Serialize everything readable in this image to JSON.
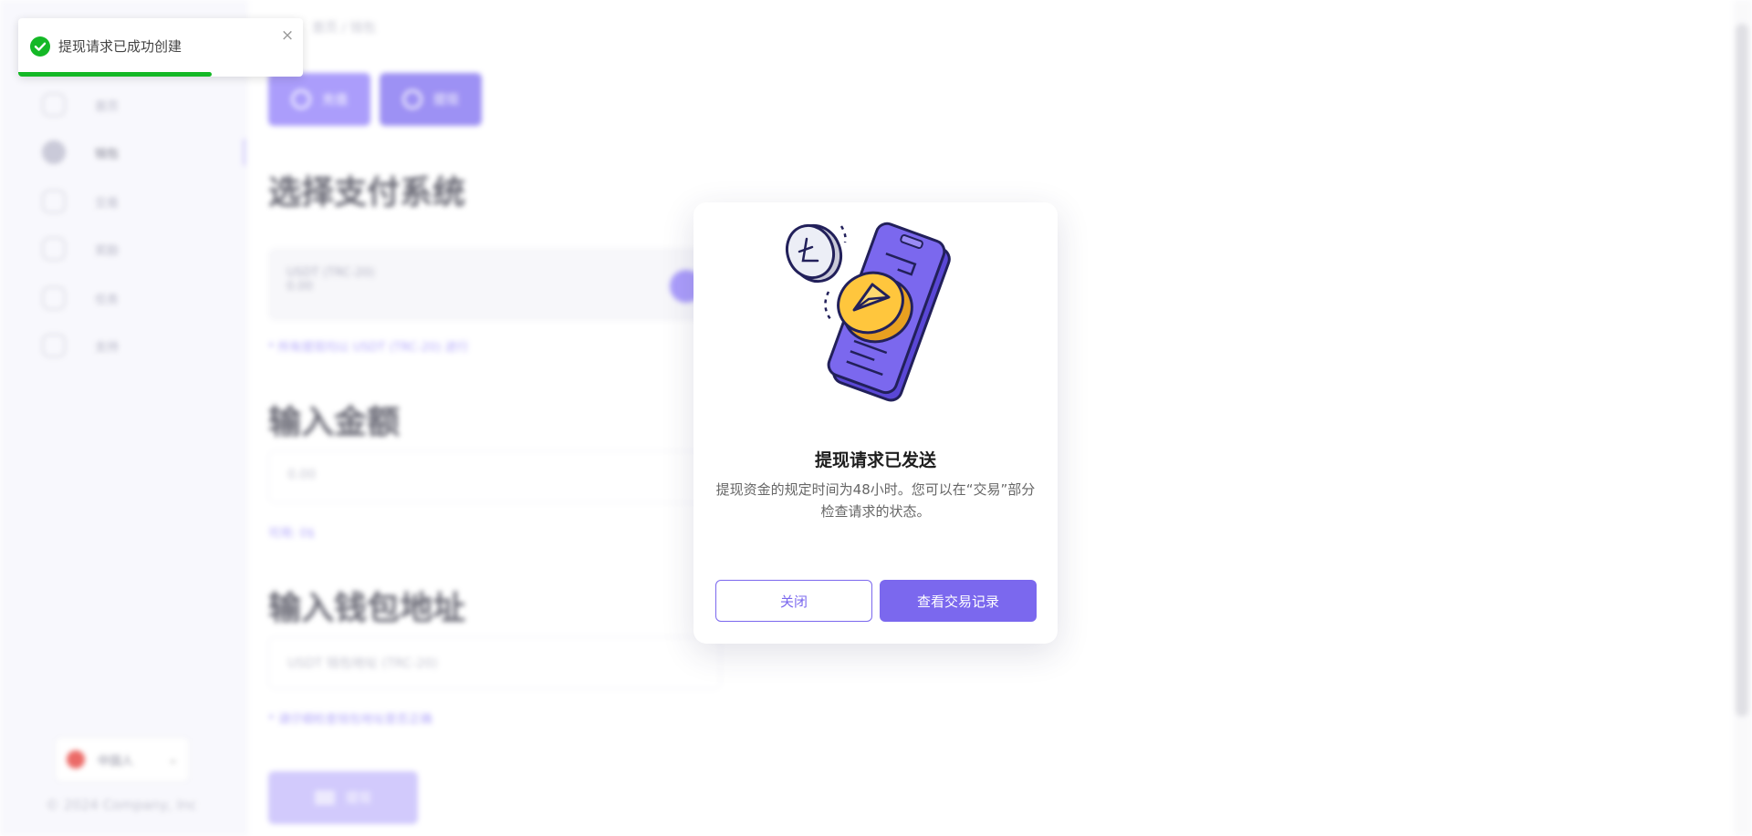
{
  "background": {
    "breadcrumb": "首页 / 钱包",
    "tabs": [
      {
        "label": "充值"
      },
      {
        "label": "提现"
      }
    ],
    "sidebar_items": [
      {
        "label": "首页",
        "icon": "home-icon"
      },
      {
        "label": "钱包",
        "icon": "wallet-icon"
      },
      {
        "label": "交易",
        "icon": "exchange-icon"
      },
      {
        "label": "奖励",
        "icon": "gift-icon"
      },
      {
        "label": "任务",
        "icon": "briefcase-icon"
      },
      {
        "label": "支持",
        "icon": "help-icon"
      }
    ],
    "sections": {
      "payment_title": "选择支付系统",
      "payment_method": "USDT (TRC-20)",
      "payment_sub": "0.00",
      "payment_hint": "* 所有提现均以 USDT (TRC-20) 进行",
      "amount_title": "输入金额",
      "amount_placeholder": "0.00",
      "amount_hint": "可用: 0$",
      "wallet_title": "输入钱包地址",
      "wallet_placeholder": "USDT 钱包地址 (TRC-20)",
      "wallet_hint": "* 请仔细检查钱包地址是否正确",
      "submit_label": "提现"
    },
    "language": "中国人",
    "copyright": "© 2024 Company, Inc"
  },
  "toast": {
    "message": "提现请求已成功创建",
    "progress_fraction": 0.68,
    "color": "#14b826"
  },
  "modal": {
    "title": "提现请求已发送",
    "description": "提现资金的规定时间为48小时。您可以在“交易”部分检查请求的状态。",
    "close_label": "关闭",
    "history_label": "查看交易记录",
    "accent": "#7b68ee"
  }
}
